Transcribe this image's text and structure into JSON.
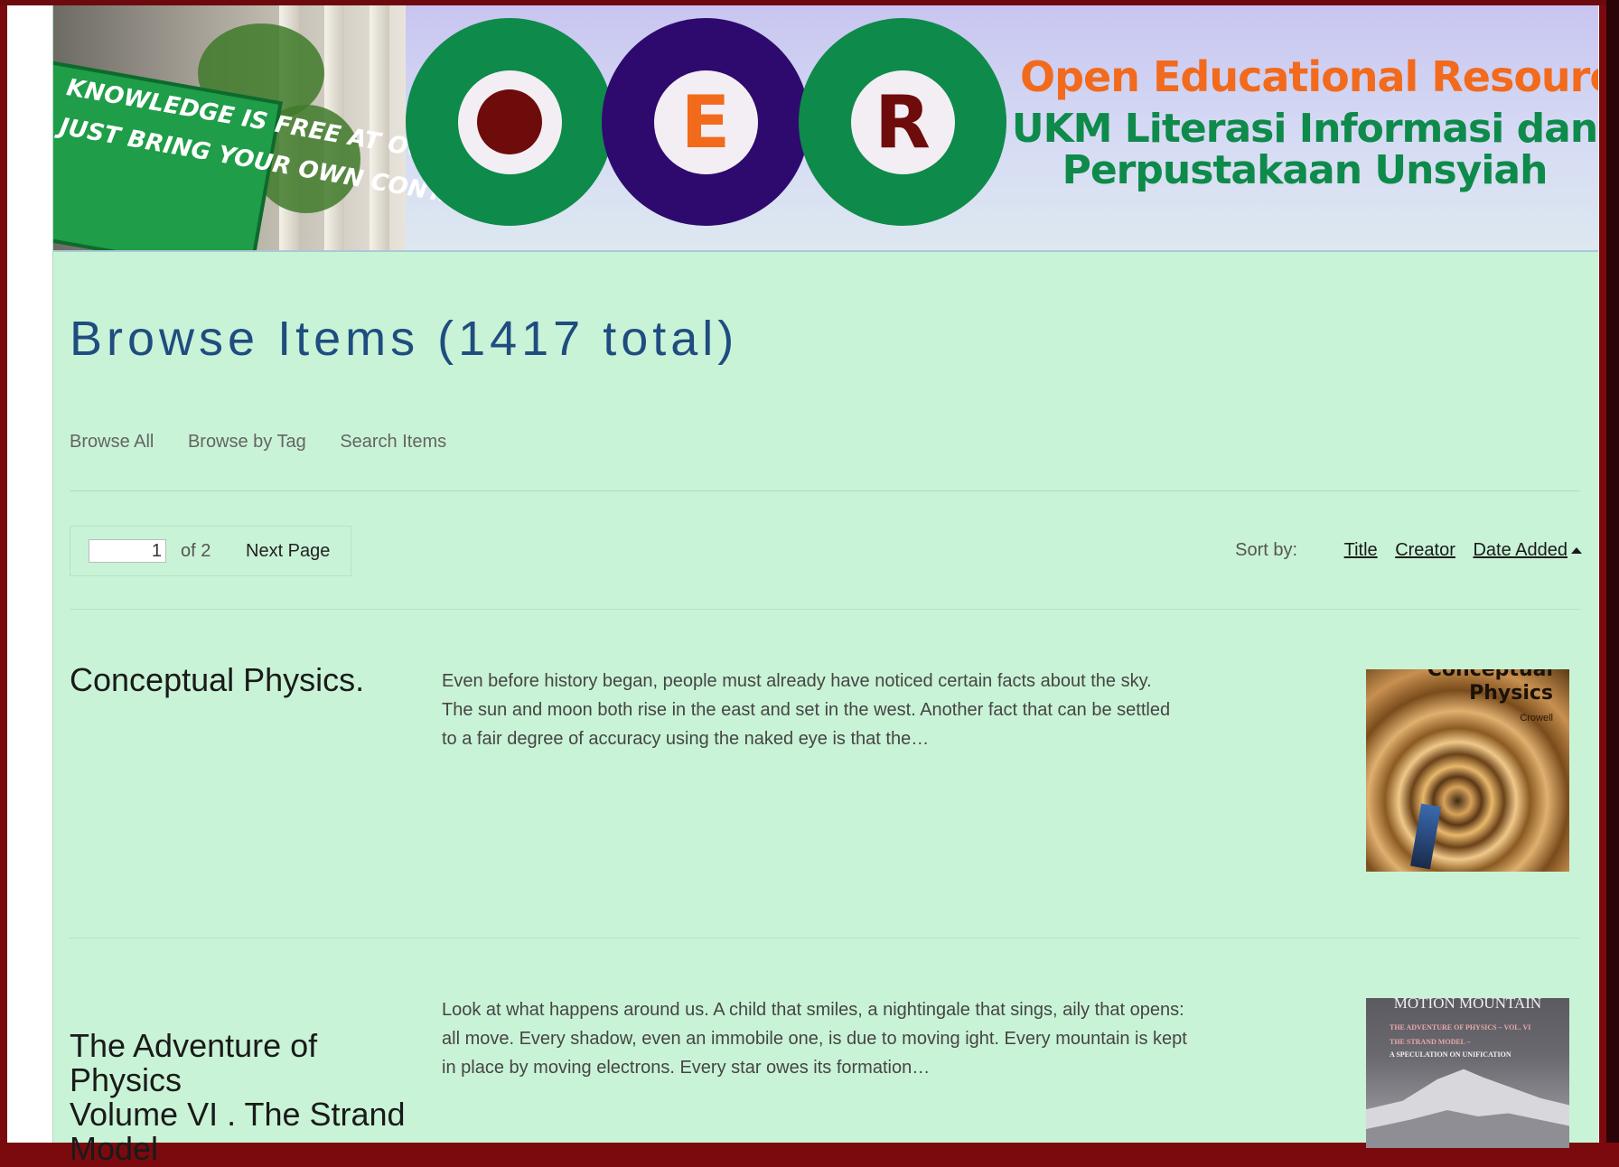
{
  "banner": {
    "sign_line1": "KNOWLEDGE IS FREE AT OUR LIBRARY",
    "sign_line2": "JUST BRING YOUR OWN CONTAINER",
    "logo_letters": [
      "",
      "E",
      "R"
    ],
    "title": "Open Educational Resources",
    "subtitle_line1": "UKM Literasi Informasi dan",
    "subtitle_line2": "Perpustakaan Unsyiah",
    "colors": {
      "green": "#0e8a4a",
      "purple": "#2e0a6e",
      "orange": "#f26a1c",
      "maroon": "#6e0b0b"
    }
  },
  "page": {
    "title": "Browse Items (1417 total)"
  },
  "subnav": {
    "items": [
      "Browse All",
      "Browse by Tag",
      "Search Items"
    ]
  },
  "pagination": {
    "current_page": "1",
    "of_label": "of 2",
    "next_label": "Next Page"
  },
  "sort": {
    "label": "Sort by:",
    "options": [
      "Title",
      "Creator",
      "Date Added"
    ],
    "active": "Date Added",
    "direction": "ascending"
  },
  "items": [
    {
      "title": "Conceptual Physics.",
      "description": "Even before history began, people must already have noticed certain facts about the sky. The sun and moon both rise in the east and set in the west. Another fact that can be settled to a fair degree of accuracy using the naked eye is that the…",
      "cover": {
        "title_top": "Conceptual",
        "title": "Physics",
        "author": "Crowell"
      }
    },
    {
      "title_lines": [
        "The Adventure of",
        "Physics",
        "Volume VI . The Strand",
        "Model"
      ],
      "description": "Look at what happens around us. A child that smiles, a nightingale that sings, aily that opens: all move. Every shadow, even an immobile one, is due to moving ight. Every mountain is kept in place by moving electrons. Every star owes its formation…",
      "cover": {
        "header": "MOTION MOUNTAIN",
        "line1": "THE ADVENTURE OF PHYSICS – VOL. VI",
        "line2": "THE STRAND MODEL –",
        "line3": "A SPECULATION ON UNIFICATION"
      }
    }
  ]
}
